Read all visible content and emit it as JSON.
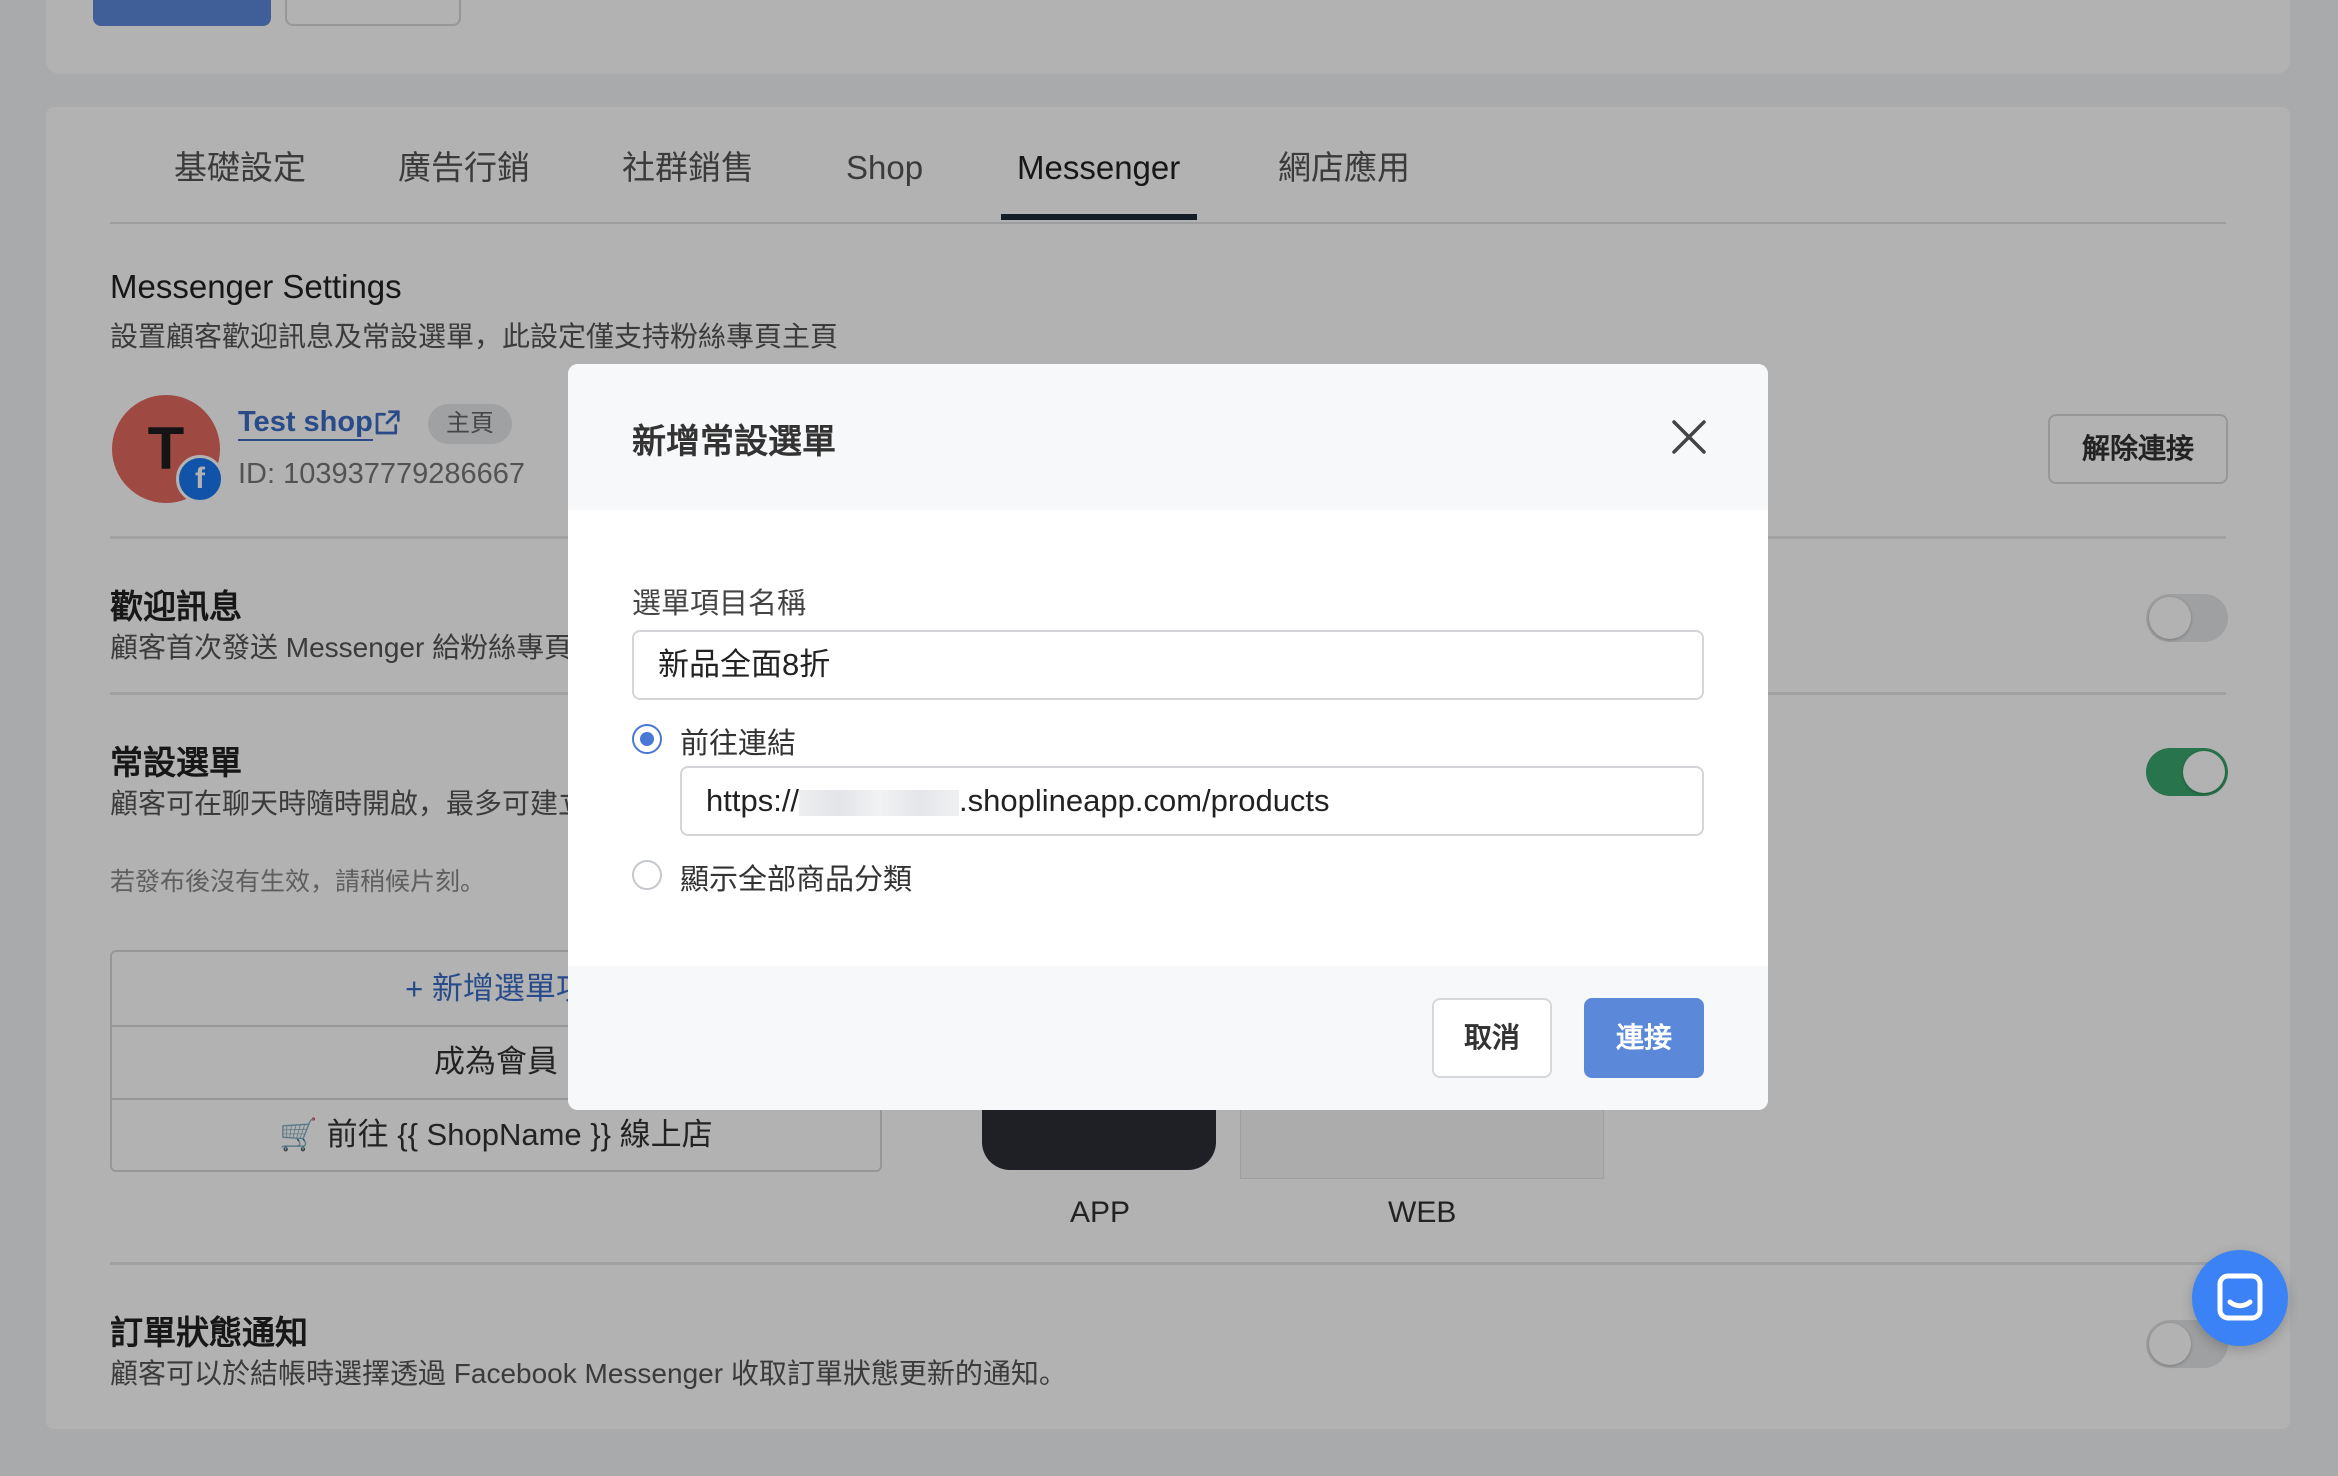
{
  "tabs": [
    {
      "label": "基礎設定"
    },
    {
      "label": "廣告行銷"
    },
    {
      "label": "社群銷售"
    },
    {
      "label": "Shop"
    },
    {
      "label": "Messenger"
    },
    {
      "label": "網店應用"
    }
  ],
  "active_tab": "Messenger",
  "settings": {
    "title": "Messenger Settings",
    "description": "設置顧客歡迎訊息及常設選單，此設定僅支持粉絲專頁主頁"
  },
  "account": {
    "avatar_letter": "T",
    "facebook_badge": "f",
    "shop_name": "Test shop",
    "badge": "主頁",
    "id_text": "ID: 103937779286667",
    "disconnect_label": "解除連接"
  },
  "welcome": {
    "title": "歡迎訊息",
    "description": "顧客首次發送 Messenger 給粉絲專頁",
    "enabled": false
  },
  "persistent_menu": {
    "title": "常設選單",
    "description": "顧客可在聊天時隨時開啟，最多可建立",
    "hint": "若發布後沒有生效，請稍候片刻。",
    "enabled": true,
    "items": [
      {
        "label": "+ 新增選單項"
      },
      {
        "label": "成為會員"
      },
      {
        "label": "🛒 前往 {{ ShopName }} 線上店"
      }
    ]
  },
  "preview": {
    "app_label": "APP",
    "web_label": "WEB"
  },
  "order_status": {
    "title": "訂單狀態通知",
    "description": "顧客可以於結帳時選擇透過 Facebook Messenger 收取訂單狀態更新的通知。",
    "enabled": false
  },
  "modal": {
    "title": "新增常設選單",
    "field_label": "選單項目名稱",
    "name_value": "新品全面8折",
    "option_link_label": "前往連結",
    "option_link_checked": true,
    "url_prefix": "https://",
    "url_suffix": ".shoplineapp.com/products",
    "option_categories_label": "顯示全部商品分類",
    "option_categories_checked": false,
    "cancel_label": "取消",
    "connect_label": "連接"
  },
  "colors": {
    "primary": "#5c88da",
    "toggle_on": "#3aa76d",
    "link": "#3b6cc6",
    "chat_widget": "#3b82f6"
  },
  "icons": [
    "external-link-icon",
    "facebook-icon",
    "close-icon",
    "chat-icon",
    "cart-icon"
  ]
}
